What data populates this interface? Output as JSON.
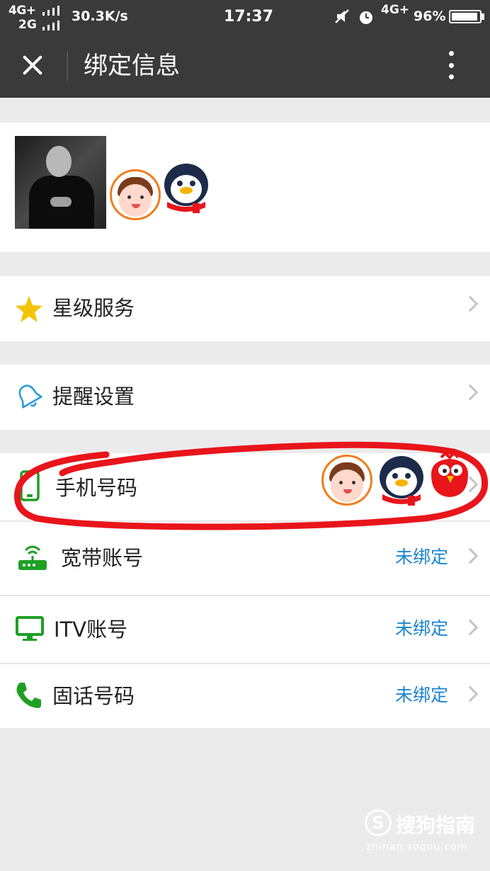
{
  "status_bar": {
    "network_primary": "4G+",
    "network_secondary": "2G",
    "speed": "30.3K/s",
    "time": "17:37",
    "network_right": "4G+",
    "battery": "96%"
  },
  "title_bar": {
    "title": "绑定信息"
  },
  "menu": {
    "star_service": "星级服务",
    "reminder": "提醒设置"
  },
  "bindings": [
    {
      "label": "手机号码",
      "status": "",
      "icon": "phone-icon"
    },
    {
      "label": "宽带账号",
      "status": "未绑定",
      "icon": "router-icon"
    },
    {
      "label": "ITV账号",
      "status": "未绑定",
      "icon": "monitor-icon"
    },
    {
      "label": "固话号码",
      "status": "未绑定",
      "icon": "telephone-icon"
    }
  ],
  "watermark": {
    "logo": "S",
    "name": "搜狗指南",
    "url": "zhinan.sogou.com"
  },
  "colors": {
    "header_bg": "#3a3a3a",
    "accent_blue": "#1a84ce",
    "icon_green": "#1ea025",
    "star_yellow": "#f5c400",
    "annotation_red": "#e8151b"
  }
}
